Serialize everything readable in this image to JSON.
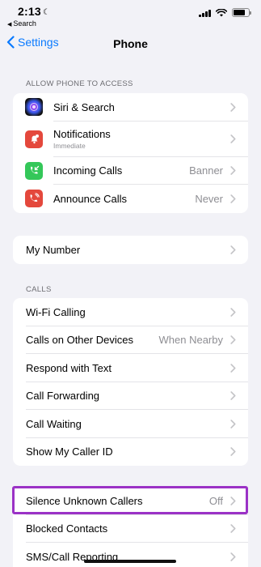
{
  "status_bar": {
    "time": "2:13",
    "moon_icon": "moon-icon",
    "back_app": "Search"
  },
  "nav": {
    "back_label": "Settings",
    "title": "Phone"
  },
  "allow_section": {
    "header": "ALLOW PHONE TO ACCESS",
    "items": [
      {
        "label": "Siri & Search",
        "sub": "",
        "value": "",
        "icon": "siri-icon",
        "icon_color": "#222"
      },
      {
        "label": "Notifications",
        "sub": "Immediate",
        "value": "",
        "icon": "notifications-icon",
        "icon_color": "#e4483c"
      },
      {
        "label": "Incoming Calls",
        "sub": "",
        "value": "Banner",
        "icon": "incoming-calls-icon",
        "icon_color": "#34c759"
      },
      {
        "label": "Announce Calls",
        "sub": "",
        "value": "Never",
        "icon": "announce-calls-icon",
        "icon_color": "#e4483c"
      }
    ]
  },
  "my_number": {
    "label": "My Number"
  },
  "calls_section": {
    "header": "CALLS",
    "items": [
      {
        "label": "Wi-Fi Calling",
        "value": ""
      },
      {
        "label": "Calls on Other Devices",
        "value": "When Nearby"
      },
      {
        "label": "Respond with Text",
        "value": ""
      },
      {
        "label": "Call Forwarding",
        "value": ""
      },
      {
        "label": "Call Waiting",
        "value": ""
      },
      {
        "label": "Show My Caller ID",
        "value": ""
      }
    ]
  },
  "blocking_section": {
    "items": [
      {
        "label": "Silence Unknown Callers",
        "value": "Off"
      },
      {
        "label": "Blocked Contacts",
        "value": ""
      },
      {
        "label": "SMS/Call Reporting",
        "value": ""
      }
    ]
  },
  "colors": {
    "accent": "#0a7aff",
    "highlight": "#9b32c6",
    "background": "#f2f2f7"
  }
}
